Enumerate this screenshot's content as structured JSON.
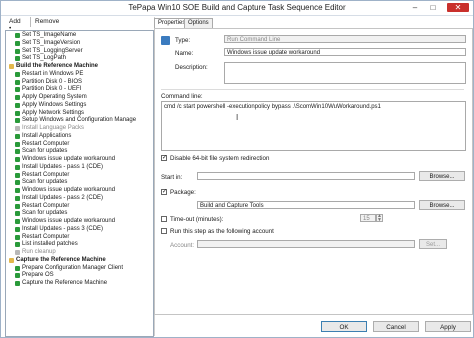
{
  "window": {
    "title": "TePapa Win10 SOE Build and Capture Task Sequence Editor"
  },
  "toolbar": {
    "add_label": "Add •",
    "remove_label": "Remove"
  },
  "tree": {
    "items": [
      {
        "label": "Set TS_ImageName",
        "kind": "step",
        "indent": 1,
        "state": "normal"
      },
      {
        "label": "Set TS_ImageVersion",
        "kind": "step",
        "indent": 1,
        "state": "normal"
      },
      {
        "label": "Set TS_LoggingServer",
        "kind": "step",
        "indent": 1,
        "state": "normal"
      },
      {
        "label": "Set TS_LogPath",
        "kind": "step",
        "indent": 1,
        "state": "normal"
      },
      {
        "label": "Build the Reference Machine",
        "kind": "group",
        "indent": 0,
        "state": "normal"
      },
      {
        "label": "Restart in Windows PE",
        "kind": "step",
        "indent": 1,
        "state": "normal"
      },
      {
        "label": "Partition Disk 0 - BIOS",
        "kind": "step",
        "indent": 1,
        "state": "normal"
      },
      {
        "label": "Partition Disk 0 - UEFI",
        "kind": "step",
        "indent": 1,
        "state": "normal"
      },
      {
        "label": "Apply Operating System",
        "kind": "step",
        "indent": 1,
        "state": "normal"
      },
      {
        "label": "Apply Windows Settings",
        "kind": "step",
        "indent": 1,
        "state": "normal"
      },
      {
        "label": "Apply Network Settings",
        "kind": "step",
        "indent": 1,
        "state": "normal"
      },
      {
        "label": "Setup Windows and Configuration Manage",
        "kind": "step",
        "indent": 1,
        "state": "normal"
      },
      {
        "label": "Install Language Packs",
        "kind": "step",
        "indent": 1,
        "state": "disabled"
      },
      {
        "label": "Install Applications",
        "kind": "step",
        "indent": 1,
        "state": "normal"
      },
      {
        "label": "Restart Computer",
        "kind": "step",
        "indent": 1,
        "state": "normal"
      },
      {
        "label": "Scan for updates",
        "kind": "step",
        "indent": 1,
        "state": "normal"
      },
      {
        "label": "Windows issue update workaround",
        "kind": "step",
        "indent": 1,
        "state": "normal"
      },
      {
        "label": "Install Updates - pass 1 (CDE)",
        "kind": "step",
        "indent": 1,
        "state": "normal"
      },
      {
        "label": "Restart Computer",
        "kind": "step",
        "indent": 1,
        "state": "normal"
      },
      {
        "label": "Scan for updates",
        "kind": "step",
        "indent": 1,
        "state": "normal"
      },
      {
        "label": "Windows issue update workaround",
        "kind": "step",
        "indent": 1,
        "state": "normal"
      },
      {
        "label": "Install Updates - pass 2 (CDE)",
        "kind": "step",
        "indent": 1,
        "state": "normal"
      },
      {
        "label": "Restart Computer",
        "kind": "step",
        "indent": 1,
        "state": "normal"
      },
      {
        "label": "Scan for updates",
        "kind": "step",
        "indent": 1,
        "state": "normal"
      },
      {
        "label": "Windows issue update workaround",
        "kind": "step",
        "indent": 1,
        "state": "normal"
      },
      {
        "label": "Install Updates - pass 3 (CDE)",
        "kind": "step",
        "indent": 1,
        "state": "normal"
      },
      {
        "label": "Restart Computer",
        "kind": "step",
        "indent": 1,
        "state": "normal"
      },
      {
        "label": "List installed patches",
        "kind": "step",
        "indent": 1,
        "state": "normal"
      },
      {
        "label": "Run cleanup",
        "kind": "step",
        "indent": 1,
        "state": "disabled"
      },
      {
        "label": "Capture the Reference Machine",
        "kind": "group",
        "indent": 0,
        "state": "normal"
      },
      {
        "label": "Prepare Configuration Manager Client",
        "kind": "step",
        "indent": 1,
        "state": "normal"
      },
      {
        "label": "Prepare OS",
        "kind": "step",
        "indent": 1,
        "state": "normal"
      },
      {
        "label": "Capture the Reference Machine",
        "kind": "step",
        "indent": 1,
        "state": "normal"
      }
    ]
  },
  "tabs": [
    {
      "label": "Properties",
      "active": true
    },
    {
      "label": "Options",
      "active": false
    }
  ],
  "properties": {
    "type_label": "Type:",
    "type_value": "Run Command Line",
    "name_label": "Name:",
    "name_value": "Windows issue update workaround",
    "description_label": "Description:",
    "description_value": "",
    "command_label": "Command line:",
    "command_value": "cmd /c start powershell -executionpolicy bypass .\\ScomWin10WuWorkaround.ps1",
    "disable_redirection_label": "Disable 64-bit file system redirection",
    "disable_redirection_checked": true,
    "start_in_label": "Start in:",
    "start_in_value": "",
    "browse_label": "Browse...",
    "package_label": "Package:",
    "package_checked": true,
    "package_value": "Build and Capture Tools",
    "timeout_label": "Time-out (minutes):",
    "timeout_checked": false,
    "timeout_value": "15",
    "run_as_label": "Run this step as the following account",
    "run_as_checked": false,
    "account_label": "Account:",
    "account_value": "",
    "set_label": "Set..."
  },
  "footer": {
    "ok_label": "OK",
    "cancel_label": "Cancel",
    "apply_label": "Apply"
  }
}
